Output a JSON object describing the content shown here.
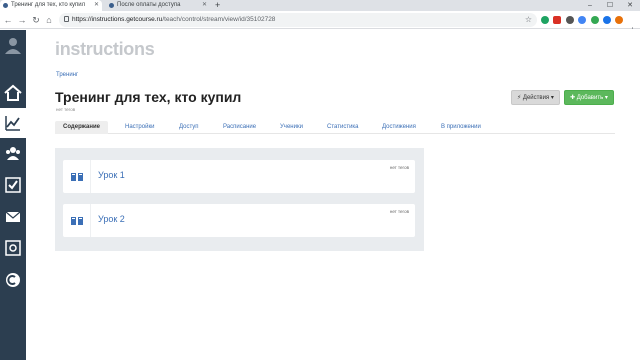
{
  "browser": {
    "tabs": [
      {
        "title": "Тренинг для тех, кто купил",
        "active": true
      },
      {
        "title": "После оплаты доступа",
        "active": false
      }
    ],
    "new_tab": "+",
    "url_host": "https://instructions.getcourse.ru",
    "url_path": "/teach/control/stream/view/id/35102728",
    "window_controls": {
      "minimize": "–",
      "maximize": "☐",
      "close": "✕"
    },
    "extension_colors": [
      "#1ea362",
      "#d93025",
      "#555555",
      "#4285f4",
      "#34a853",
      "#f4b400",
      "#1a73e8",
      "#e8710a",
      "#1a73e8"
    ]
  },
  "sidebar": {
    "items": [
      {
        "icon": "user-avatar-icon",
        "active": false
      },
      {
        "icon": "home-icon",
        "active": false
      },
      {
        "icon": "chart-icon",
        "active": true
      },
      {
        "icon": "users-icon",
        "active": false
      },
      {
        "icon": "checkbox-icon",
        "active": false
      },
      {
        "icon": "mail-icon",
        "active": false
      },
      {
        "icon": "safe-icon",
        "active": false
      },
      {
        "icon": "chat-icon",
        "active": false
      }
    ],
    "background_color": "#2c3e50"
  },
  "main": {
    "logo": "instructions",
    "breadcrumb": "Тренинг",
    "title": "Тренинг для тех, кто купил",
    "tags_note": "нет тегов",
    "actions_button": "Действия",
    "add_button": "Добавить",
    "tabs": [
      {
        "label": "Содержание",
        "active": true
      },
      {
        "label": "Настройки",
        "active": false
      },
      {
        "label": "Доступ",
        "active": false
      },
      {
        "label": "Расписание",
        "active": false
      },
      {
        "label": "Ученики",
        "active": false
      },
      {
        "label": "Статистика",
        "active": false
      },
      {
        "label": "Достижения",
        "active": false
      },
      {
        "label": "В приложении",
        "active": false
      }
    ],
    "lessons": [
      {
        "title": "Урок 1",
        "tags": "нет тегов"
      },
      {
        "title": "Урок 2",
        "tags": "нет тегов"
      }
    ]
  },
  "colors": {
    "link": "#3b6fb6",
    "add_button": "#5cb85c",
    "actions_button": "#d9d9d9"
  }
}
